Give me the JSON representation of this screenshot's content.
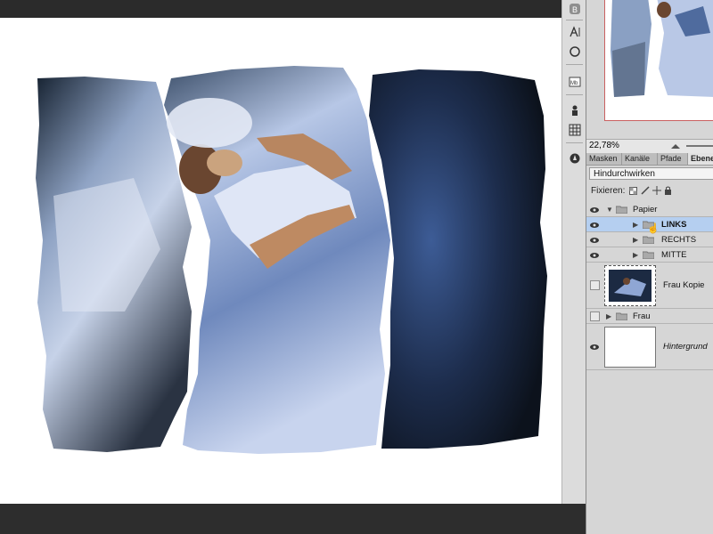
{
  "panel": {
    "zoom": "22,78%",
    "tabs": [
      "Masken",
      "Kanäle",
      "Pfade",
      "Ebenen"
    ],
    "active_tab": "Ebenen",
    "blend_mode": "Hindurchwirken",
    "lock_label": "Fixieren:",
    "layers": [
      {
        "name": "Papier",
        "type": "group",
        "expanded": true,
        "visible": true
      },
      {
        "name": "LINKS",
        "type": "group",
        "visible": true,
        "selected": true
      },
      {
        "name": "RECHTS",
        "type": "group",
        "visible": true
      },
      {
        "name": "MITTE",
        "type": "group",
        "visible": true
      },
      {
        "name": "Frau Kopie",
        "type": "image",
        "visible": false
      },
      {
        "name": "Frau",
        "type": "group",
        "visible": false
      },
      {
        "name": "Hintergrund",
        "type": "background",
        "visible": true
      }
    ]
  },
  "colors": {
    "selection": "#b5cff0",
    "accent_nav_frame": "#c96060",
    "photo_dark": "#1c2535",
    "photo_light": "#c9d6ef"
  },
  "icons": {
    "toolstrip": [
      "bridge-icon",
      "character-icon",
      "paragraph-icon",
      "minibridge-icon",
      "clone-source-icon",
      "styles-icon",
      "compass-icon"
    ],
    "lock": [
      "lock-transparency-icon",
      "lock-pixels-icon",
      "lock-position-icon",
      "lock-all-icon"
    ]
  }
}
